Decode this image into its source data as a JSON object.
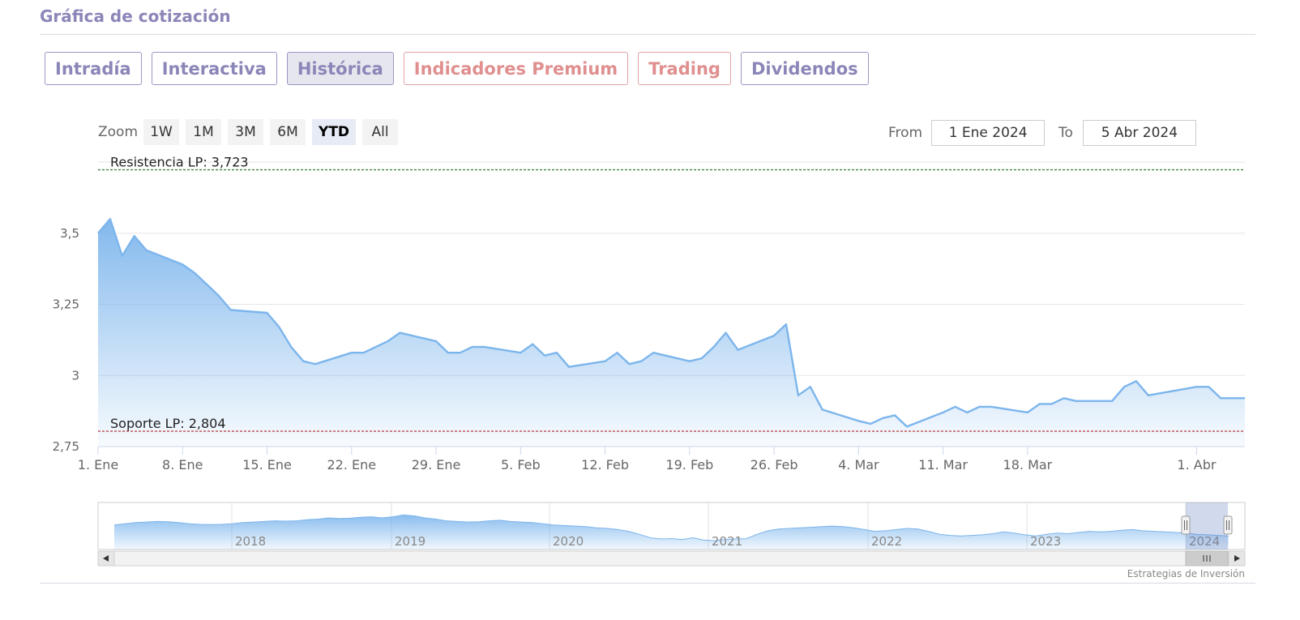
{
  "section": {
    "title": "Gráfica de cotización"
  },
  "tabs": [
    {
      "label": "Intradía",
      "state": "normal"
    },
    {
      "label": "Interactiva",
      "state": "normal"
    },
    {
      "label": "Histórica",
      "state": "active"
    },
    {
      "label": "Indicadores Premium",
      "state": "premium"
    },
    {
      "label": "Trading",
      "state": "premium"
    },
    {
      "label": "Dividendos",
      "state": "normal"
    }
  ],
  "zoom": {
    "label": "Zoom",
    "buttons": [
      "1W",
      "1M",
      "3M",
      "6M",
      "YTD",
      "All"
    ],
    "selected": "YTD"
  },
  "range": {
    "from_label": "From",
    "from_value": "1 Ene 2024",
    "to_label": "To",
    "to_value": "5 Abr 2024"
  },
  "colors": {
    "line": "#7cb5ec",
    "resistance": "#2e7d32",
    "support": "#b22222",
    "accent": "#8b86b8",
    "premium": "#e08f8f"
  },
  "chart_data": {
    "type": "area",
    "xaxis_type": "date",
    "x": [
      "2024-01-01",
      "2024-01-02",
      "2024-01-03",
      "2024-01-04",
      "2024-01-05",
      "2024-01-08",
      "2024-01-09",
      "2024-01-10",
      "2024-01-11",
      "2024-01-12",
      "2024-01-15",
      "2024-01-16",
      "2024-01-17",
      "2024-01-18",
      "2024-01-19",
      "2024-01-22",
      "2024-01-23",
      "2024-01-24",
      "2024-01-25",
      "2024-01-26",
      "2024-01-29",
      "2024-01-30",
      "2024-01-31",
      "2024-02-01",
      "2024-02-02",
      "2024-02-05",
      "2024-02-06",
      "2024-02-07",
      "2024-02-08",
      "2024-02-09",
      "2024-02-12",
      "2024-02-13",
      "2024-02-14",
      "2024-02-15",
      "2024-02-16",
      "2024-02-19",
      "2024-02-20",
      "2024-02-21",
      "2024-02-22",
      "2024-02-23",
      "2024-02-26",
      "2024-02-27",
      "2024-02-28",
      "2024-02-29",
      "2024-03-01",
      "2024-03-04",
      "2024-03-05",
      "2024-03-06",
      "2024-03-07",
      "2024-03-08",
      "2024-03-11",
      "2024-03-12",
      "2024-03-13",
      "2024-03-14",
      "2024-03-15",
      "2024-03-18",
      "2024-03-19",
      "2024-03-20",
      "2024-03-21",
      "2024-03-22",
      "2024-03-25",
      "2024-03-26",
      "2024-03-27",
      "2024-03-28",
      "2024-04-01",
      "2024-04-02",
      "2024-04-03",
      "2024-04-04",
      "2024-04-05"
    ],
    "series": [
      {
        "values": [
          3.5,
          3.55,
          3.42,
          3.49,
          3.44,
          3.39,
          3.36,
          3.32,
          3.28,
          3.23,
          3.22,
          3.17,
          3.1,
          3.05,
          3.04,
          3.08,
          3.08,
          3.1,
          3.12,
          3.15,
          3.12,
          3.08,
          3.08,
          3.1,
          3.1,
          3.08,
          3.11,
          3.07,
          3.08,
          3.03,
          3.05,
          3.08,
          3.04,
          3.05,
          3.08,
          3.05,
          3.06,
          3.1,
          3.15,
          3.09,
          3.14,
          3.18,
          2.93,
          2.96,
          2.88,
          2.84,
          2.83,
          2.85,
          2.86,
          2.82,
          2.87,
          2.89,
          2.87,
          2.89,
          2.89,
          2.87,
          2.9,
          2.9,
          2.92,
          2.91,
          2.91,
          2.96,
          2.98,
          2.93,
          2.96,
          2.96,
          2.92,
          2.92,
          2.92
        ]
      }
    ],
    "ylim": [
      2.75,
      3.75
    ],
    "y_ticks": [
      "2,75",
      "3",
      "3,25",
      "3,5"
    ],
    "x_tick_labels": [
      {
        "date": "2024-01-01",
        "label": "1. Ene"
      },
      {
        "date": "2024-01-08",
        "label": "8. Ene"
      },
      {
        "date": "2024-01-15",
        "label": "15. Ene"
      },
      {
        "date": "2024-01-22",
        "label": "22. Ene"
      },
      {
        "date": "2024-01-29",
        "label": "29. Ene"
      },
      {
        "date": "2024-02-05",
        "label": "5. Feb"
      },
      {
        "date": "2024-02-12",
        "label": "12. Feb"
      },
      {
        "date": "2024-02-19",
        "label": "19. Feb"
      },
      {
        "date": "2024-02-26",
        "label": "26. Feb"
      },
      {
        "date": "2024-03-04",
        "label": "4. Mar"
      },
      {
        "date": "2024-03-11",
        "label": "11. Mar"
      },
      {
        "date": "2024-03-18",
        "label": "18. Mar"
      },
      {
        "date": "2024-04-01",
        "label": "1. Abr"
      }
    ],
    "plot_lines": [
      {
        "label": "Resistencia LP: 3,723",
        "value": 3.723,
        "style": "dashed",
        "color": "#2e7d32"
      },
      {
        "label": "Soporte LP: 2,804",
        "value": 2.804,
        "style": "dashed",
        "color": "#b22222"
      }
    ],
    "grid": true,
    "legend": "none",
    "navigator": {
      "year_labels": [
        "2018",
        "2019",
        "2020",
        "2021",
        "2022",
        "2023",
        "2024"
      ],
      "values": [
        0.62,
        0.66,
        0.7,
        0.72,
        0.74,
        0.73,
        0.7,
        0.66,
        0.64,
        0.63,
        0.64,
        0.66,
        0.7,
        0.72,
        0.74,
        0.76,
        0.75,
        0.76,
        0.8,
        0.82,
        0.86,
        0.84,
        0.85,
        0.88,
        0.9,
        0.86,
        0.9,
        0.96,
        0.93,
        0.86,
        0.82,
        0.76,
        0.74,
        0.72,
        0.73,
        0.76,
        0.78,
        0.74,
        0.72,
        0.7,
        0.66,
        0.62,
        0.6,
        0.58,
        0.56,
        0.52,
        0.5,
        0.46,
        0.4,
        0.3,
        0.18,
        0.14,
        0.15,
        0.12,
        0.18,
        0.1,
        0.08,
        0.12,
        0.14,
        0.15,
        0.3,
        0.42,
        0.48,
        0.5,
        0.52,
        0.54,
        0.56,
        0.58,
        0.56,
        0.52,
        0.46,
        0.4,
        0.42,
        0.46,
        0.5,
        0.48,
        0.4,
        0.3,
        0.26,
        0.24,
        0.26,
        0.28,
        0.32,
        0.38,
        0.34,
        0.28,
        0.24,
        0.3,
        0.34,
        0.32,
        0.36,
        0.4,
        0.38,
        0.4,
        0.44,
        0.46,
        0.42,
        0.4,
        0.38,
        0.36,
        0.34,
        0.3,
        0.28,
        0.26,
        0.24
      ],
      "selection_start": "2024-01-01",
      "selection_end": "2024-04-05"
    }
  },
  "credits": "Estrategias de Inversión"
}
